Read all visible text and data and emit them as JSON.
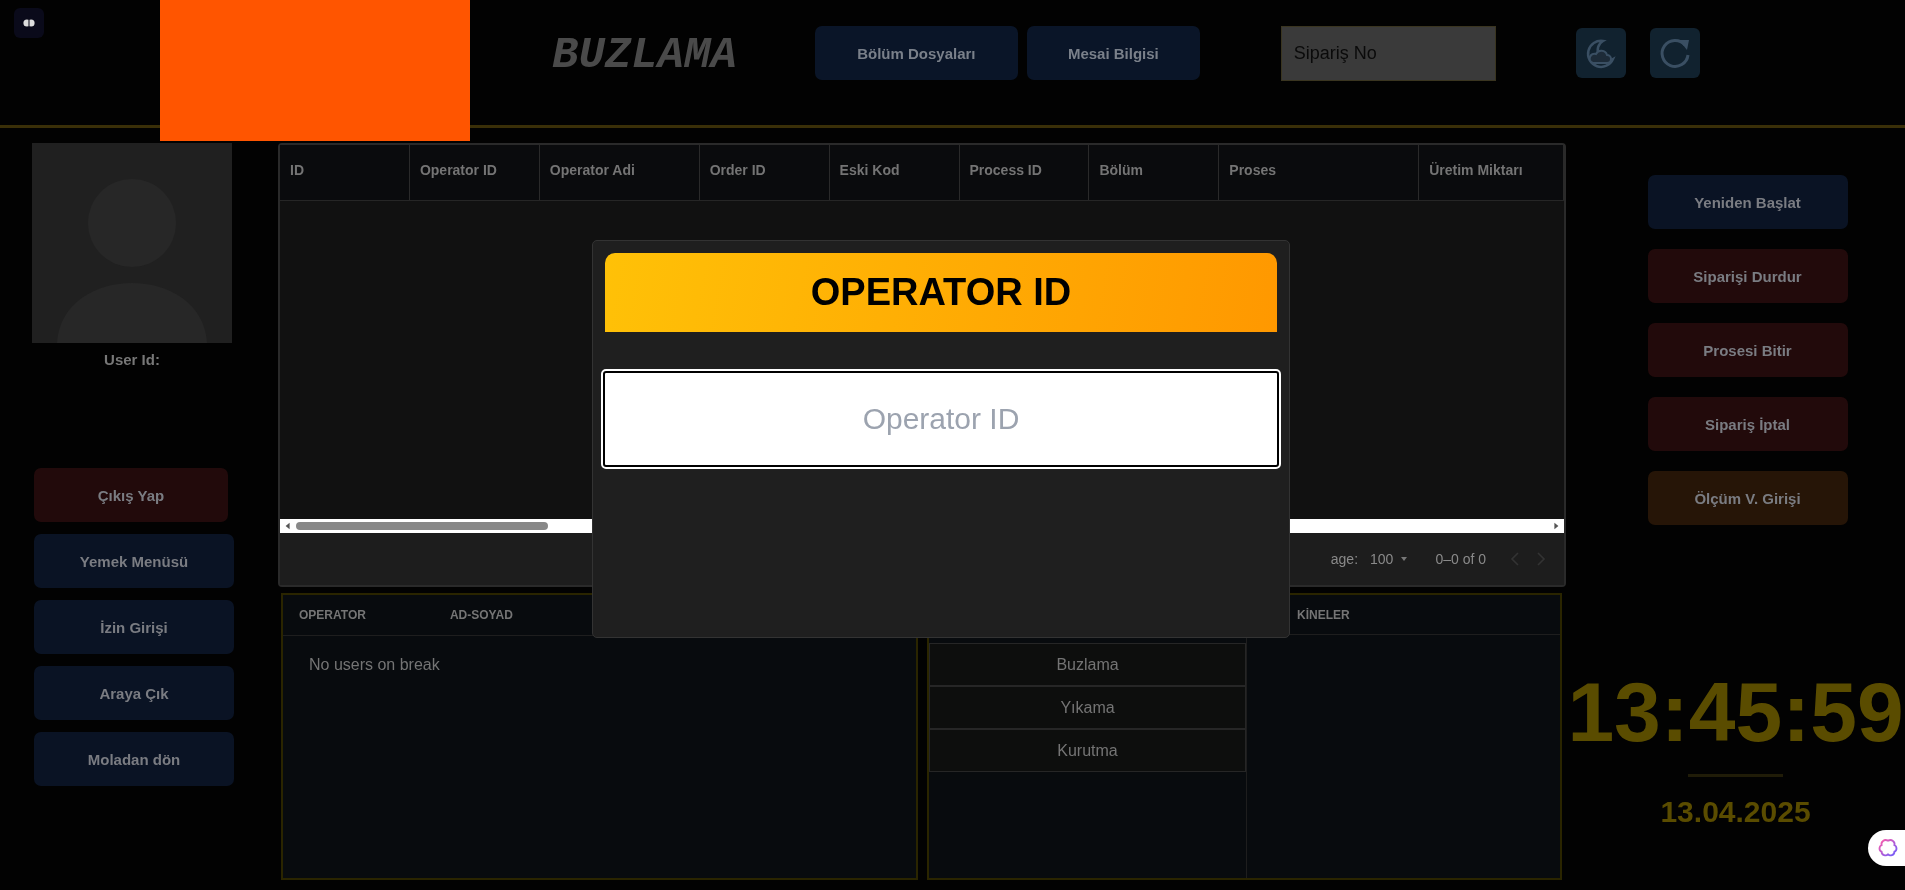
{
  "header": {
    "title": "BUZLAMA",
    "buttons": [
      "Bölüm Dosyaları",
      "Mesai Bilgisi"
    ],
    "search": {
      "placeholder": "Sipariş No"
    }
  },
  "user": {
    "label": "User Id:"
  },
  "left_buttons": [
    {
      "label": "Çıkış Yap",
      "kind": "danger"
    },
    {
      "label": "Yemek Menüsü",
      "kind": "primary"
    },
    {
      "label": "İzin Girişi",
      "kind": "primary"
    },
    {
      "label": "Araya Çık",
      "kind": "primary"
    },
    {
      "label": "Moladan dön",
      "kind": "primary"
    }
  ],
  "table": {
    "columns": [
      "ID",
      "Operator ID",
      "Operator Adi",
      "Order ID",
      "Eski Kod",
      "Process ID",
      "Bölüm",
      "Proses",
      "Üretim Miktarı"
    ],
    "footer": {
      "rows_label": "age:",
      "rows_per_page": "100",
      "range": "0–0 of 0"
    }
  },
  "break_panel": {
    "columns": [
      "OPERATOR",
      "AD-SOYAD"
    ],
    "empty": "No users on break"
  },
  "machines_panel": {
    "heading": "KİNELER",
    "processes": [
      "Buzlama",
      "Yıkama",
      "Kurutma"
    ]
  },
  "right_buttons": [
    {
      "label": "Yeniden Başlat",
      "kind": "primary"
    },
    {
      "label": "Siparişi Durdur",
      "kind": "danger"
    },
    {
      "label": "Prosesi Bitir",
      "kind": "danger"
    },
    {
      "label": "Sipariş İptal",
      "kind": "danger"
    },
    {
      "label": "Ölçüm V. Girişi",
      "kind": "warning"
    }
  ],
  "clock": {
    "time": "13:45:59",
    "date": "13.04.2025"
  },
  "modal": {
    "title": "OPERATOR ID",
    "input": {
      "placeholder": "Operator ID"
    }
  }
}
